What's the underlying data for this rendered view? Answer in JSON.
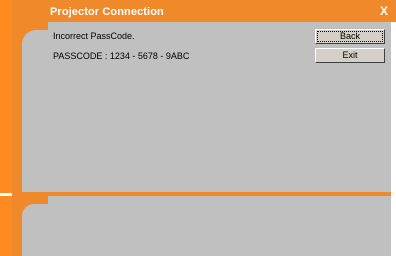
{
  "window": {
    "title": "Projector Connection",
    "close_label": "X"
  },
  "messages": {
    "error": "Incorrect PassCode.",
    "passcode": "PASSCODE : 1234 - 5678 - 9ABC"
  },
  "buttons": {
    "back": "Back",
    "exit": "Exit"
  },
  "colors": {
    "accent": "#f0892a",
    "panel": "#c0c0c0"
  }
}
